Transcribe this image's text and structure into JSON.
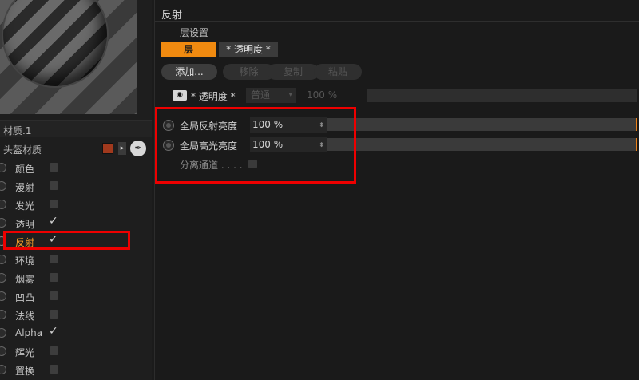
{
  "left": {
    "material_name": "材质.1",
    "material_type": "头盔材质",
    "material_color": "#a0391d",
    "channels": [
      {
        "label": "颜色",
        "checked": false
      },
      {
        "label": "漫射",
        "checked": false
      },
      {
        "label": "发光",
        "checked": false
      },
      {
        "label": "透明",
        "checked": true
      },
      {
        "label": "反射",
        "checked": true,
        "active": true
      },
      {
        "label": "环境",
        "checked": false
      },
      {
        "label": "烟雾",
        "checked": false
      },
      {
        "label": "凹凸",
        "checked": false
      },
      {
        "label": "法线",
        "checked": false
      },
      {
        "label": "Alpha",
        "checked": true
      },
      {
        "label": "辉光",
        "checked": false
      },
      {
        "label": "置换",
        "checked": false
      }
    ]
  },
  "right": {
    "section_title": "反射",
    "layer_settings_label": "层设置",
    "tabs": {
      "layer": "层",
      "transparency": "* 透明度 *"
    },
    "buttons": {
      "add": "添加...",
      "delete": "移除",
      "copy": "复制",
      "paste": "粘贴"
    },
    "transparency": {
      "label": "* 透明度 *",
      "mode": "普通",
      "value": "100 %"
    },
    "params": {
      "global_reflect": {
        "label": "全局反射亮度",
        "value": "100 %"
      },
      "global_specular": {
        "label": "全局高光亮度",
        "value": "100 %"
      },
      "separate_pass": {
        "label": "分离通道 . . . ."
      }
    }
  },
  "colors": {
    "accent": "#f08a10",
    "highlight_box": "#e00000"
  }
}
